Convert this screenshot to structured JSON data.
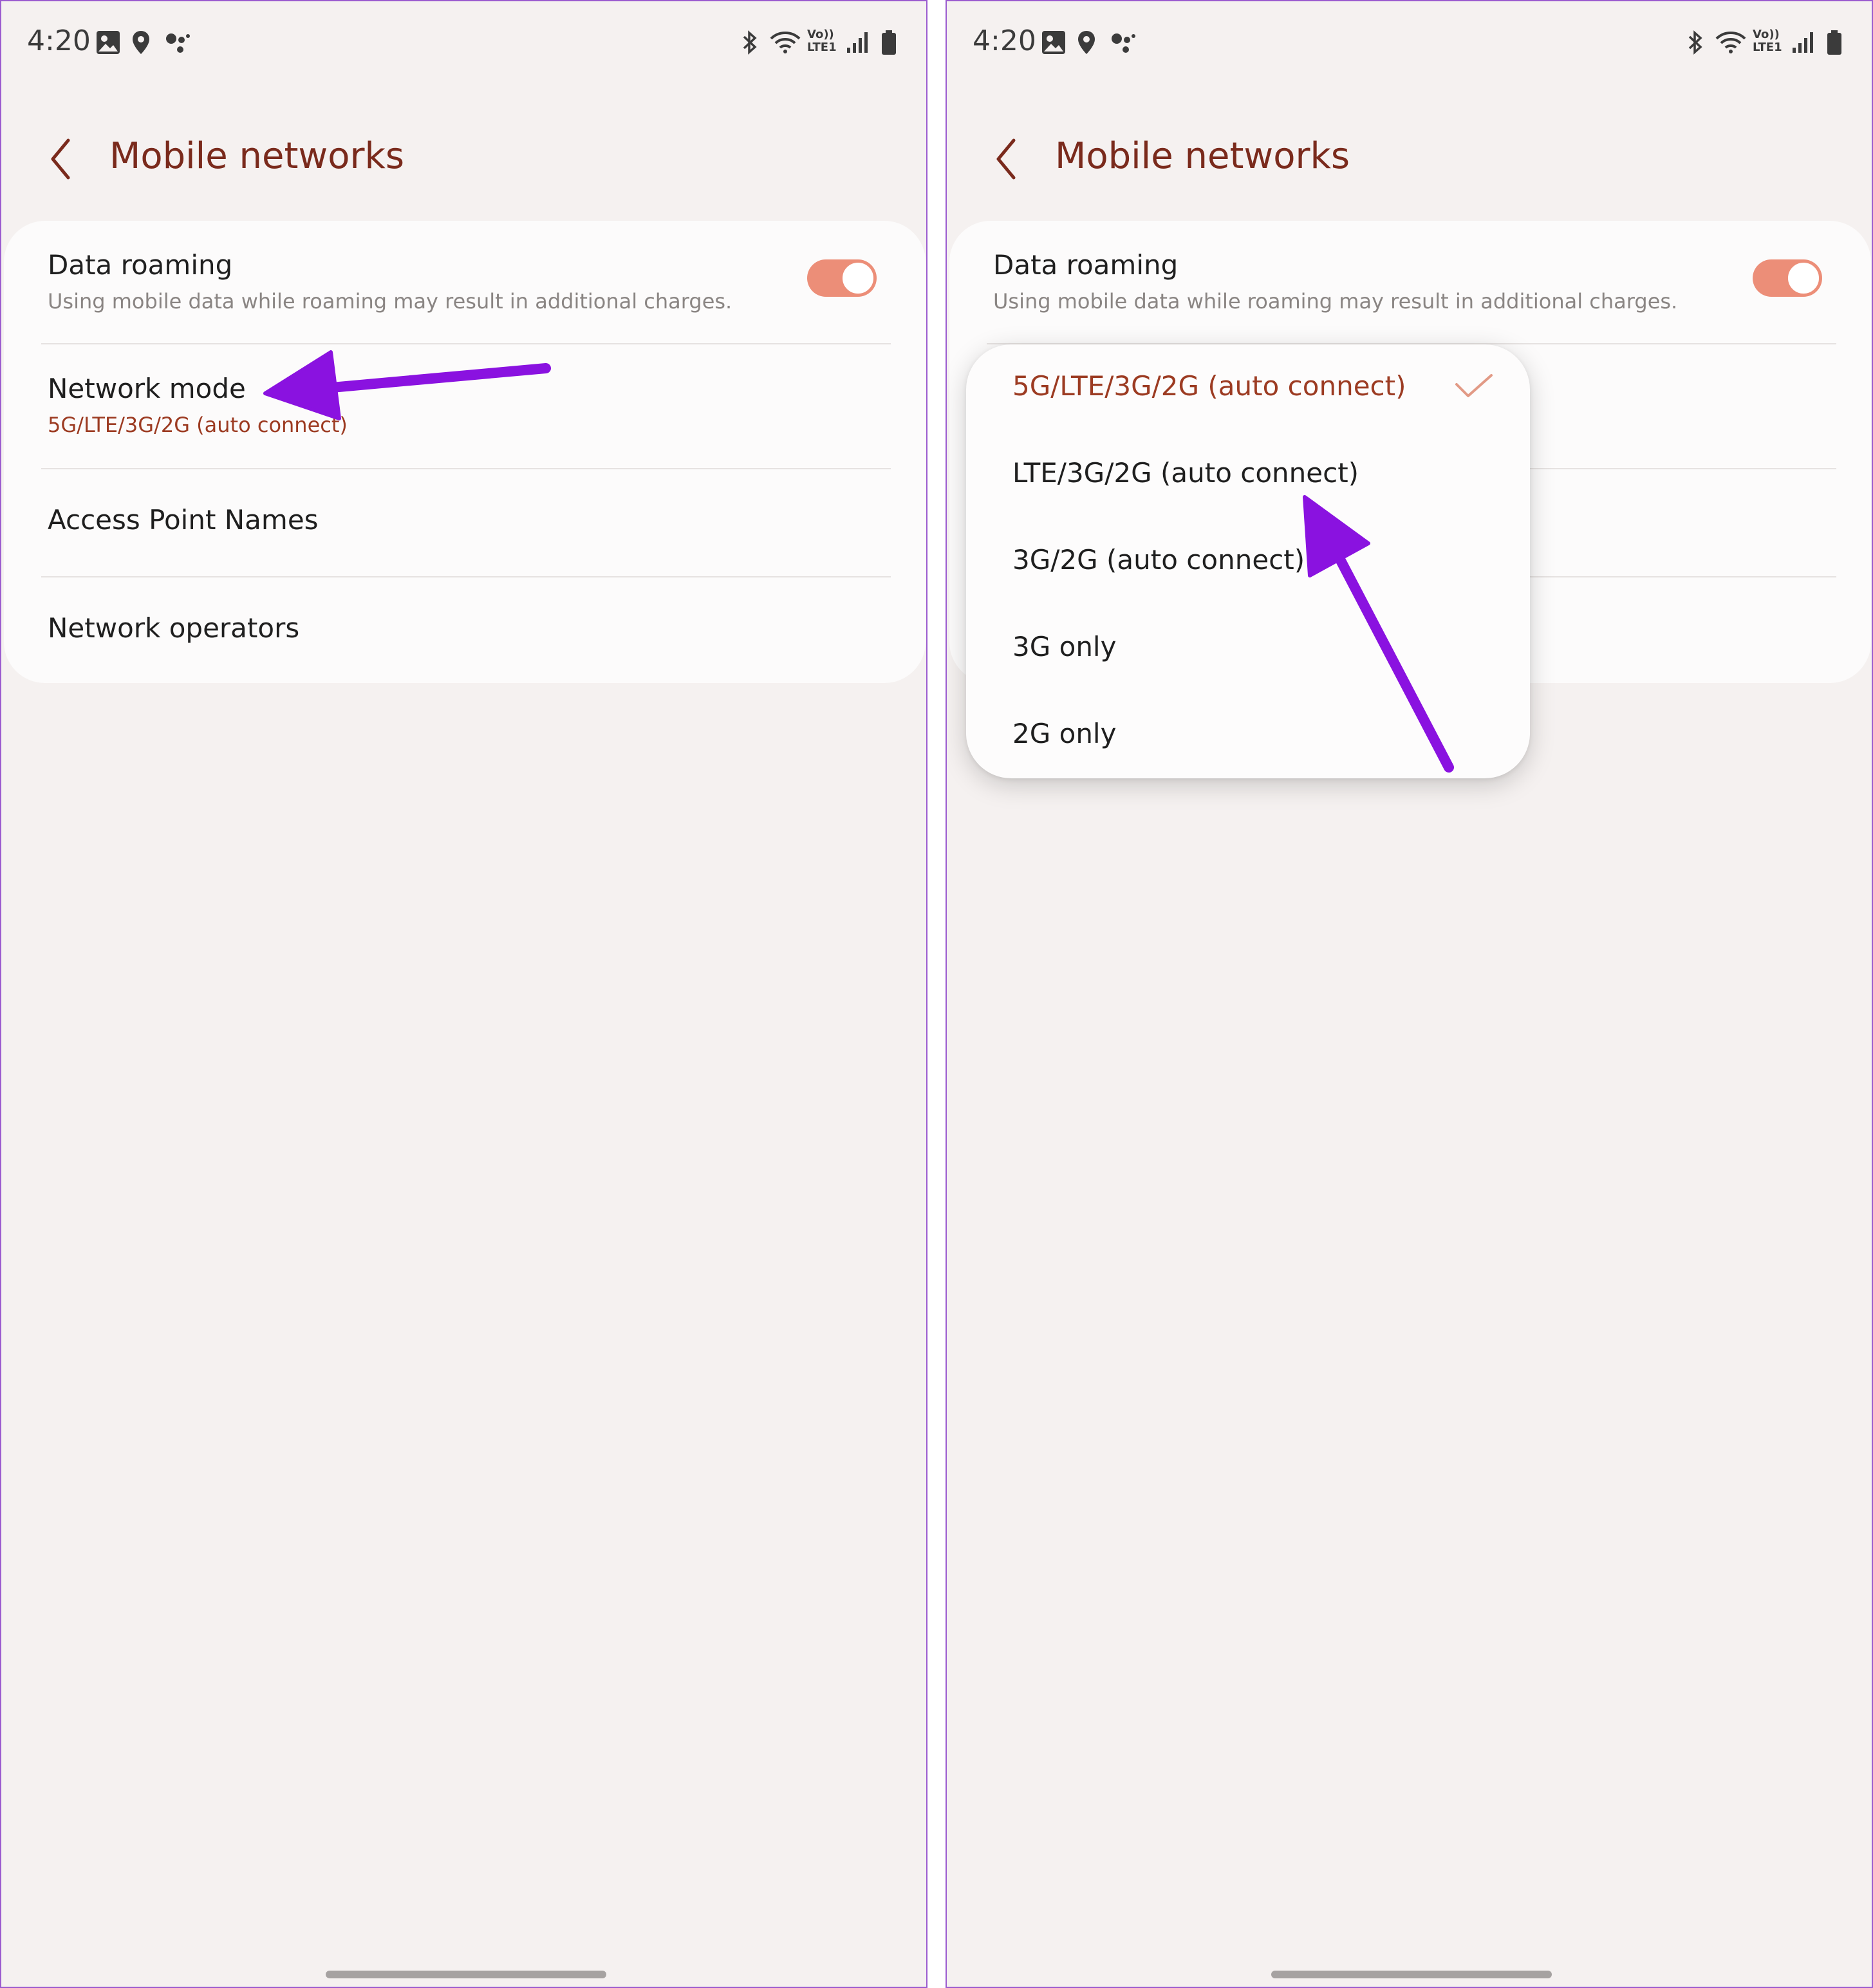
{
  "status_bar": {
    "time": "4:20",
    "left_icons": [
      "image-icon",
      "location-icon",
      "assistant-dots-icon"
    ],
    "right_icons": [
      "bluetooth-icon",
      "wifi-icon",
      "volte-icon",
      "signal-icon",
      "battery-icon"
    ],
    "volte_top": "Vo))",
    "volte_bottom": "LTE1"
  },
  "header": {
    "back_label": "Back",
    "title": "Mobile networks"
  },
  "settings": {
    "data_roaming": {
      "title": "Data roaming",
      "subtitle": "Using mobile data while roaming may result in additional charges.",
      "enabled": true
    },
    "network_mode": {
      "title": "Network mode",
      "value": "5G/LTE/3G/2G (auto connect)"
    },
    "access_point_names": {
      "title": "Access Point Names"
    },
    "network_operators": {
      "title": "Network operators"
    }
  },
  "network_mode_options": [
    {
      "label": "5G/LTE/3G/2G (auto connect)",
      "selected": true
    },
    {
      "label": "LTE/3G/2G (auto connect)",
      "selected": false
    },
    {
      "label": "3G/2G (auto connect)",
      "selected": false
    },
    {
      "label": "3G only",
      "selected": false
    },
    {
      "label": "2G only",
      "selected": false
    }
  ],
  "colors": {
    "accent_title": "#7a2a1c",
    "accent_value": "#9c3b22",
    "toggle_on": "#ec8e78",
    "annotation_arrow": "#8a12e0",
    "panel_border": "#9b5ccf",
    "background": "#f5f1f0"
  }
}
